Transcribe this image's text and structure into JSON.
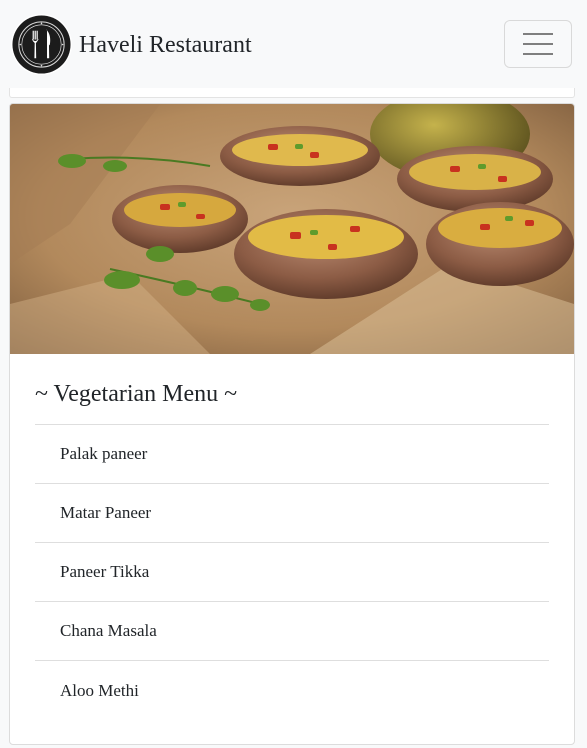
{
  "header": {
    "brand_name": "Haveli Restaurant",
    "logo_icon": "fork-knife-logo-icon",
    "menu_toggle_icon": "hamburger-icon"
  },
  "hero": {
    "image": "stuffed-mushrooms-photo"
  },
  "menu": {
    "title": "~ Vegetarian Menu ~",
    "items": [
      {
        "label": "Palak paneer"
      },
      {
        "label": "Matar Paneer"
      },
      {
        "label": "Paneer Tikka"
      },
      {
        "label": "Chana Masala"
      },
      {
        "label": "Aloo Methi"
      }
    ]
  },
  "colors": {
    "navbar_bg": "#f8f9fa",
    "card_bg": "#ffffff",
    "text": "#212529",
    "divider": "#dedede"
  }
}
